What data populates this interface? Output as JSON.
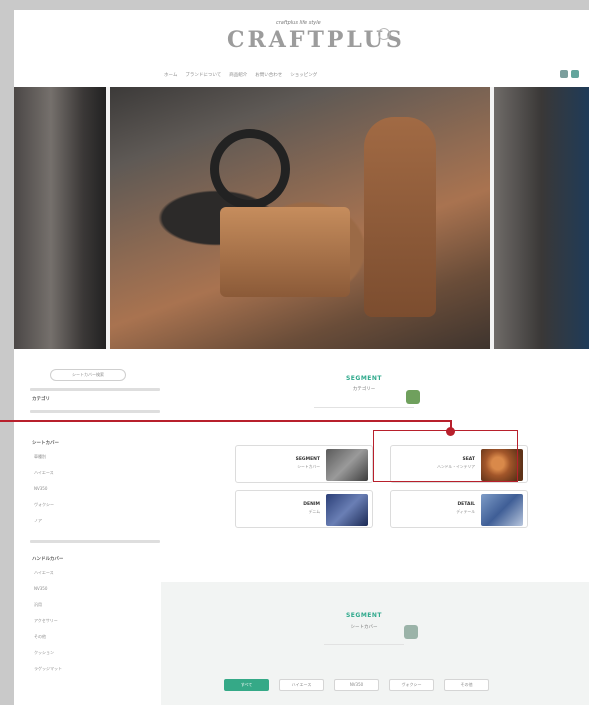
{
  "header": {
    "tagline": "craftplus life style",
    "logo_text": "CRAFTPLUS",
    "nav": [
      "ホーム",
      "ブランドについて",
      "商品紹介",
      "お問い合わせ",
      "ショッピング"
    ]
  },
  "sidebar": {
    "button_label": "シートカバー検索",
    "heading_1": "カテゴリ",
    "heading_2": "シートカバー",
    "items_1": [
      "車種別",
      "ハイエース",
      "NV350",
      "ヴォクシー",
      "ノア"
    ],
    "heading_3": "ハンドルカバー",
    "items_2": [
      "ハイエース",
      "NV350",
      "汎用",
      "アクセサリー",
      "その他",
      "クッション",
      "ラゲッジマット"
    ]
  },
  "seat_section": {
    "title_en": "SEGMENT",
    "title_jp": "カテゴリー",
    "cards": [
      {
        "en": "SEGMENT",
        "jp": "シートカバー",
        "thumb": "grey"
      },
      {
        "en": "SEAT",
        "jp": "ハンドル・インテリア",
        "thumb": "brown"
      },
      {
        "en": "DENIM",
        "jp": "デニム",
        "thumb": "blue1"
      },
      {
        "en": "DETAIL",
        "jp": "ディテール",
        "thumb": "blue2"
      }
    ]
  },
  "lower_section": {
    "title_en": "SEGMENT",
    "title_jp": "シートカバー",
    "tabs": [
      "すべて",
      "ハイエース",
      "NV350",
      "ヴォクシー",
      "その他"
    ]
  },
  "colors": {
    "accent": "#35a987",
    "callout": "#b8202c",
    "background": "#c9c9c9"
  }
}
